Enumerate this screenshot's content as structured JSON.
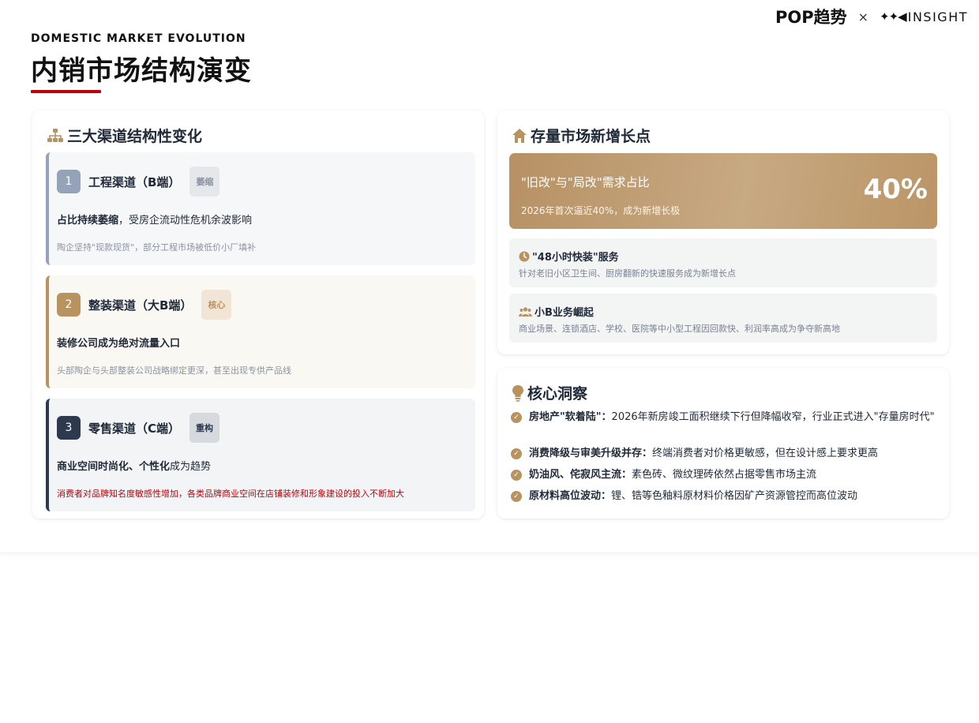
{
  "brand": {
    "logo_text": "POP趋势",
    "cross": "×",
    "partner_text": "INSIGHT",
    "partner_mark": "✦✦◀"
  },
  "header": {
    "eyebrow": "DOMESTIC MARKET EVOLUTION",
    "title": "内销市场结构演变",
    "accent_color": "#c0000a"
  },
  "channels_card": {
    "title": "三大渠道结构性变化",
    "icon": "sitemap-icon",
    "items": [
      {
        "num": "1",
        "name": "工程渠道（B端）",
        "tag": "萎缩",
        "lead_bold": "占比持续萎缩",
        "lead_rest": "，受房企流动性危机余波影响",
        "note": "陶企坚持\"现款现货\"，部分工程市场被低价小厂填补",
        "color": "#94a3b8"
      },
      {
        "num": "2",
        "name": "整装渠道（大B端）",
        "tag": "核心",
        "lead_bold": "装修公司成为绝对流量入口",
        "lead_rest": "",
        "note": "头部陶企与头部整装公司战略绑定更深，甚至出现专供产品线",
        "color": "#b8935f"
      },
      {
        "num": "3",
        "name": "零售渠道（C端）",
        "tag": "重构",
        "lead_bold": "商业空间时尚化、个性化",
        "lead_rest": "成为趋势",
        "note": "消费者对品牌知名度敏感性增加，各类品牌商业空间在店铺装修和形象建设的投入不断加大",
        "color": "#2d3a4e"
      }
    ]
  },
  "stock_card": {
    "title": "存量市场新增长点",
    "icon": "house-icon",
    "hero": {
      "headline": "\"旧改\"与\"局改\"需求占比",
      "sub": "2026年首次逼近40%，成为新增长极",
      "value": "40%"
    },
    "points": [
      {
        "title": "\"48小时快装\"服务",
        "icon": "clock-icon",
        "desc": "针对老旧小区卫生间、厨房翻新的快速服务成为新增长点"
      },
      {
        "title": "小B业务崛起",
        "icon": "users-icon",
        "desc": "商业场景、连锁酒店、学校、医院等中小型工程因回款快、利润率高成为争夺新高地"
      }
    ]
  },
  "insight_card": {
    "title": "核心洞察",
    "icon": "lightbulb-icon",
    "items": [
      {
        "bold": "房地产\"软着陆\"：",
        "text": "2026年新房竣工面积继续下行但降幅收窄，行业正式进入\"存量房时代\""
      },
      {
        "bold": "消费降级与审美升级并存：",
        "text": "终端消费者对价格更敏感，但在设计感上要求更高"
      },
      {
        "bold": "奶油风、侘寂风主流：",
        "text": "素色砖、微纹理砖依然占据零售市场主流"
      },
      {
        "bold": "原材料高位波动：",
        "text": "锂、锆等色釉料原材料价格因矿产资源管控而高位波动"
      }
    ]
  }
}
